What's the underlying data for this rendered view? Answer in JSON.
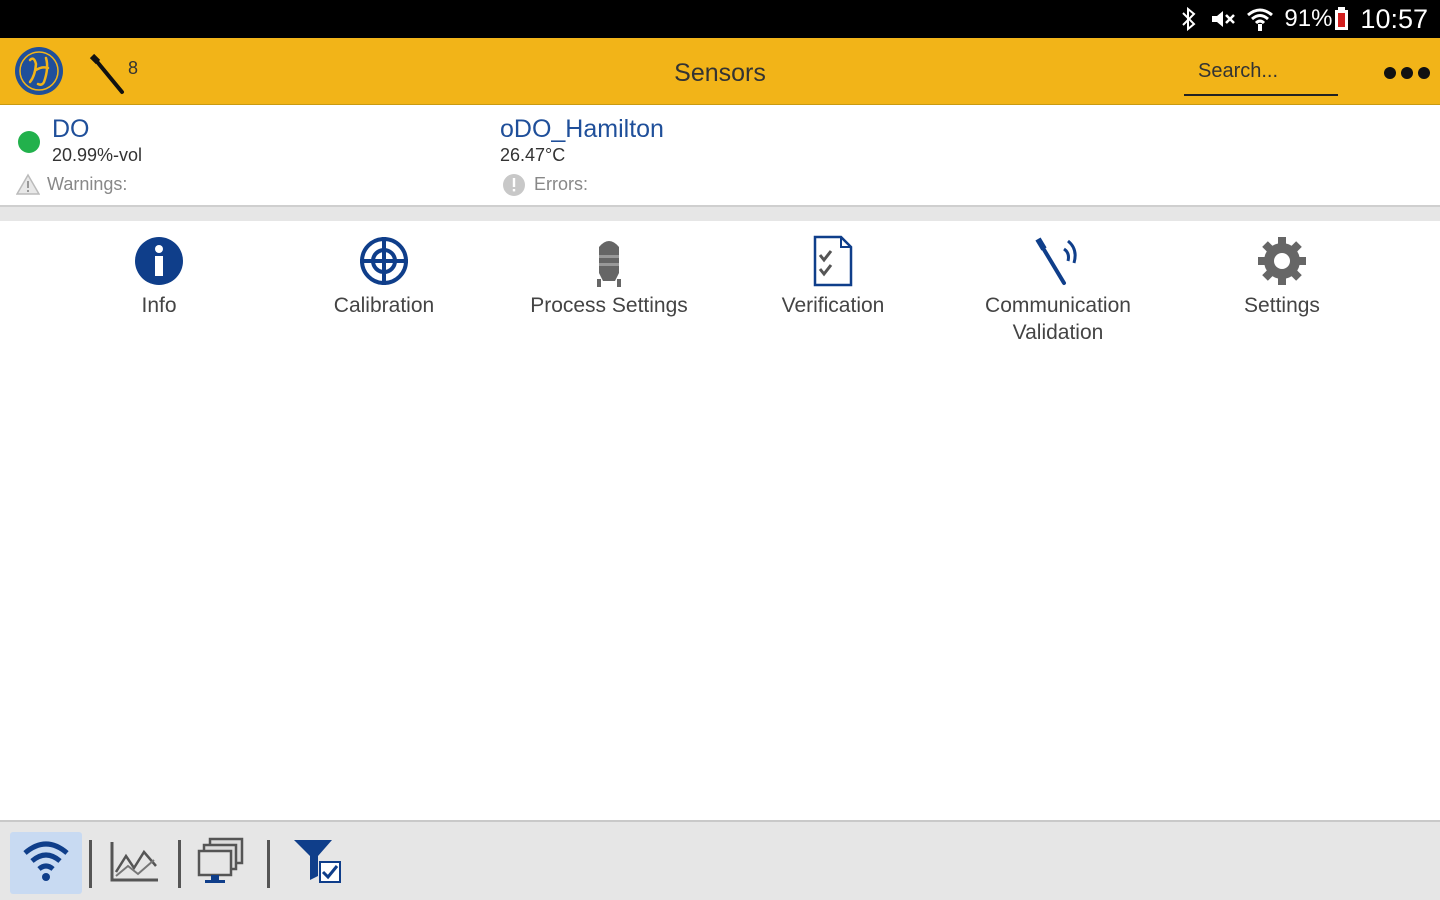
{
  "status_bar": {
    "battery_percent": "91%",
    "time": "10:57",
    "icons": [
      "bluetooth-icon",
      "muted-icon",
      "wifi-icon",
      "battery-icon"
    ]
  },
  "app_bar": {
    "title": "Sensors",
    "sensor_count": "8",
    "search_placeholder": "Search...",
    "accent_color": "#F2B418"
  },
  "sensors": [
    {
      "name": "DO",
      "value": "20.99%-vol",
      "status_label": "Warnings:",
      "status_color": "#22b14c"
    },
    {
      "name": "oDO_Hamilton",
      "value": "26.47°C",
      "status_label": "Errors:"
    }
  ],
  "actions": [
    {
      "label": "Info",
      "icon": "info-icon"
    },
    {
      "label": "Calibration",
      "icon": "calibration-target-icon"
    },
    {
      "label": "Process Settings",
      "icon": "silo-icon"
    },
    {
      "label": "Verification",
      "icon": "checklist-document-icon"
    },
    {
      "label": "Communication Validation",
      "icon": "wireless-probe-icon"
    },
    {
      "label": "Settings",
      "icon": "gear-icon"
    }
  ],
  "bottom_bar": {
    "buttons": [
      {
        "icon": "wifi-icon",
        "active": true
      },
      {
        "icon": "line-chart-icon",
        "active": false
      },
      {
        "icon": "monitors-icon",
        "active": false
      },
      {
        "icon": "filter-check-icon",
        "active": false
      }
    ]
  }
}
